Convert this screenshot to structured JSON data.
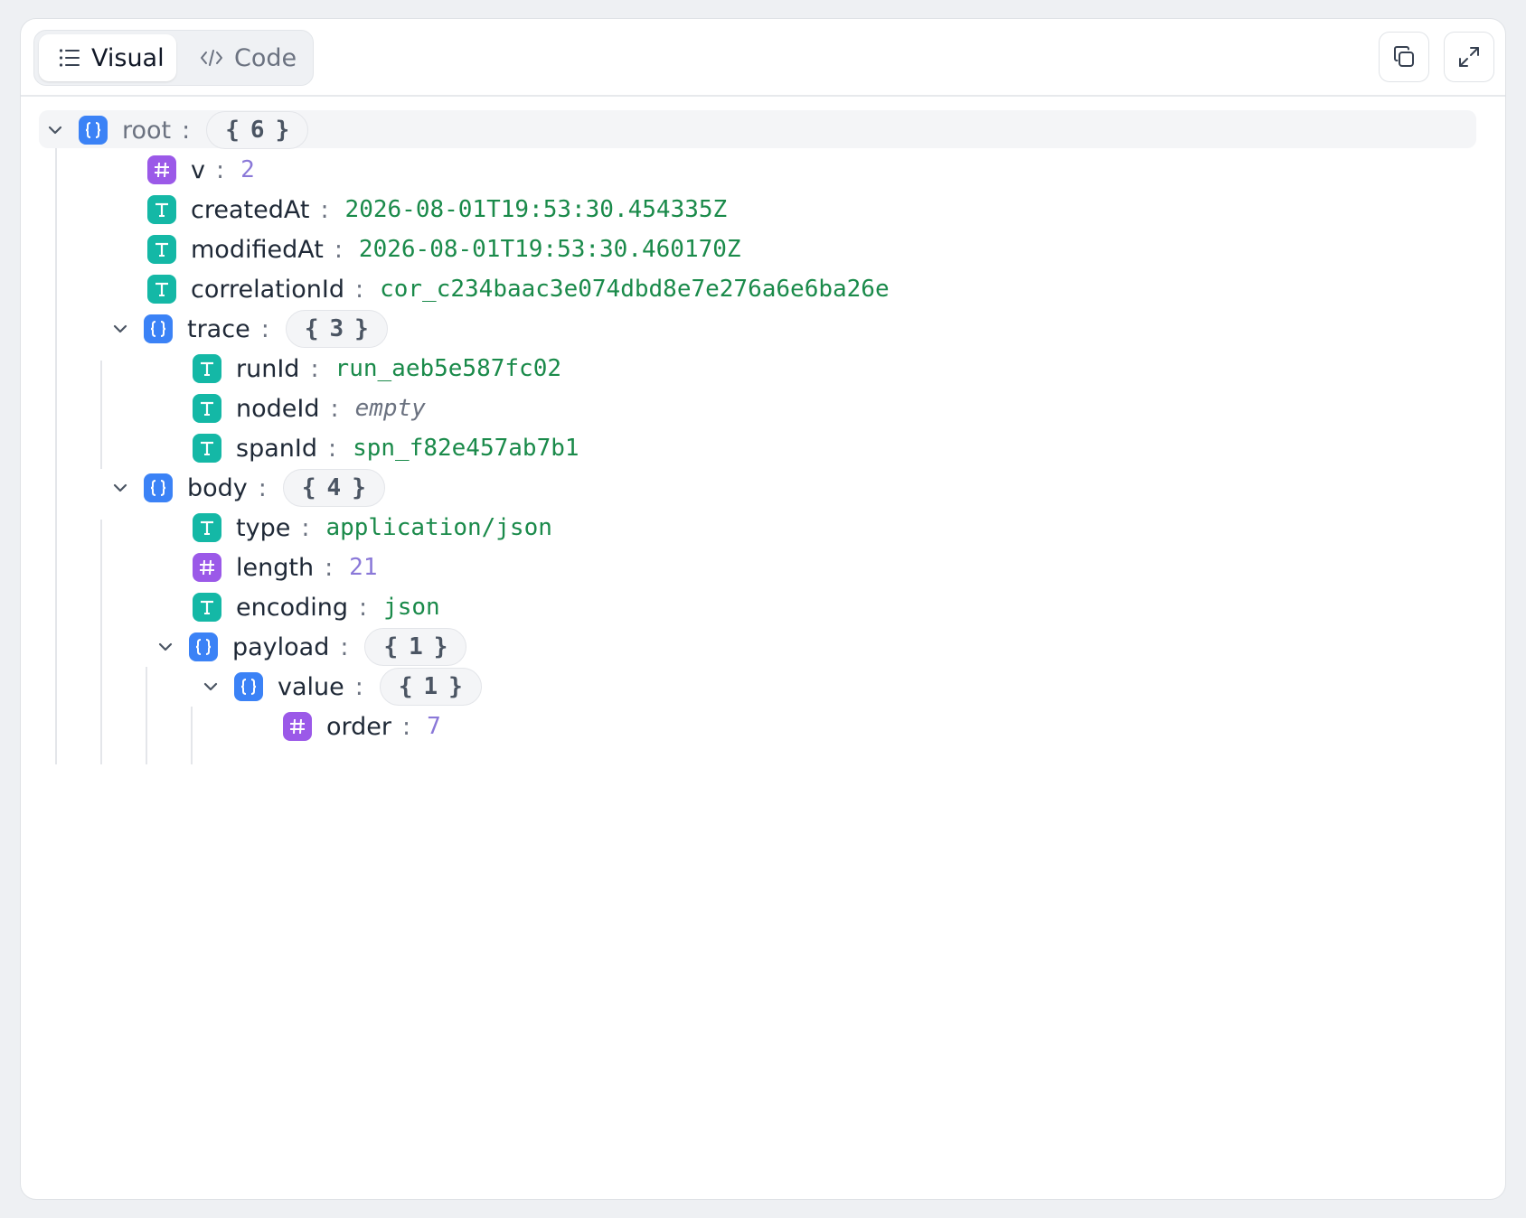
{
  "toolbar": {
    "visual_label": "Visual",
    "code_label": "Code",
    "copy_icon": "copy-icon",
    "expand_icon": "expand-icon"
  },
  "tree": {
    "root": {
      "key": "root",
      "count": "6"
    },
    "v": {
      "key": "v",
      "value": "2"
    },
    "createdAt": {
      "key": "createdAt",
      "value": "2026-08-01T19:53:30.454335Z"
    },
    "modifiedAt": {
      "key": "modifiedAt",
      "value": "2026-08-01T19:53:30.460170Z"
    },
    "correlationId": {
      "key": "correlationId",
      "value": "cor_c234baac3e074dbd8e7e276a6e6ba26e"
    },
    "trace": {
      "key": "trace",
      "count": "3",
      "runId": {
        "key": "runId",
        "value": "run_aeb5e587fc02"
      },
      "nodeId": {
        "key": "nodeId",
        "value": "empty"
      },
      "spanId": {
        "key": "spanId",
        "value": "spn_f82e457ab7b1"
      }
    },
    "body": {
      "key": "body",
      "count": "4",
      "type": {
        "key": "type",
        "value": "application/json"
      },
      "length": {
        "key": "length",
        "value": "21"
      },
      "encoding": {
        "key": "encoding",
        "value": "json"
      },
      "payload": {
        "key": "payload",
        "count": "1",
        "value": {
          "key": "value",
          "count": "1",
          "order": {
            "key": "order",
            "value": "7"
          }
        }
      }
    }
  },
  "colors": {
    "object_badge": "#3b82f6",
    "string_badge": "#14b8a6",
    "number_badge": "#9b59e8",
    "string_value": "#1a8a4a",
    "number_value": "#8a78d8"
  }
}
